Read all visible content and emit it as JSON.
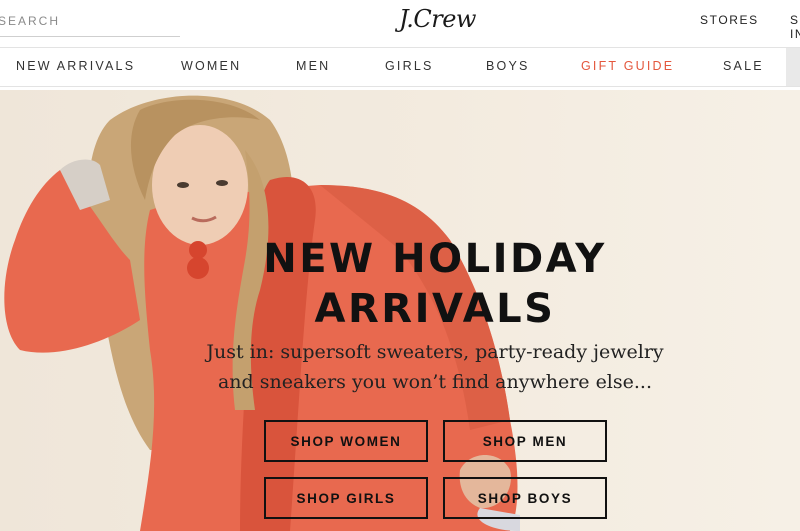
{
  "header": {
    "search": {
      "placeholder": "SEARCH",
      "value": ""
    },
    "logo": "J.Crew",
    "stores_label": "STORES",
    "sign_in_label": "SIGN IN"
  },
  "nav": {
    "items": [
      {
        "label": "NEW ARRIVALS"
      },
      {
        "label": "WOMEN"
      },
      {
        "label": "MEN"
      },
      {
        "label": "GIRLS"
      },
      {
        "label": "BOYS"
      },
      {
        "label": "GIFT GUIDE",
        "color": "#e4573d"
      },
      {
        "label": "SALE"
      }
    ]
  },
  "hero": {
    "headline_line1": "NEW HOLIDAY",
    "headline_line2": "ARRIVALS",
    "subtext_line1": "Just in: supersoft sweaters, party-ready jewelry",
    "subtext_line2": "and sneakers you won’t find anywhere else...",
    "buttons": {
      "women": "SHOP WOMEN",
      "men": "SHOP MEN",
      "girls": "SHOP GIRLS",
      "boys": "SHOP BOYS"
    },
    "colors": {
      "background": "#f1e9dd",
      "sweater": "#e8694f",
      "accent": "#e4573d"
    }
  }
}
